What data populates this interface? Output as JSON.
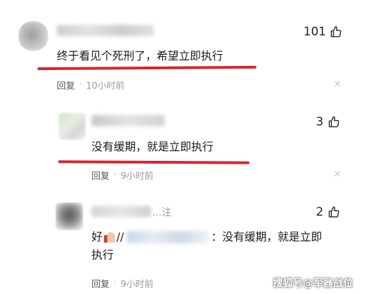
{
  "comments": [
    {
      "likes": "101",
      "text": "终于看见个死刑了，希望立即执行",
      "reply_label": "回复",
      "separator": "·",
      "time": "10小时前",
      "close": "×"
    },
    {
      "likes": "3",
      "text": "没有缓期，就是立即执行",
      "reply_label": "回复",
      "separator": "·",
      "time": "9小时前",
      "close": "×"
    },
    {
      "likes": "2",
      "text_prefix": "好",
      "text_sep": "//",
      "text_main": "：没有缓期，就是立即",
      "text_line2": "执行",
      "reply_label": "回复",
      "separator": "·",
      "time": "9小时前",
      "name_tail": "...注",
      "close": "×"
    }
  ],
  "watermark": "搜狐号@军器战位",
  "colors": {
    "underline": "#d8242f",
    "meta": "#9a9a9a"
  }
}
